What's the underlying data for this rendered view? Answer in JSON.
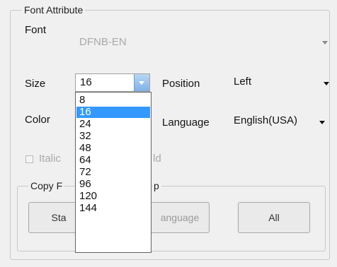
{
  "font_attribute": {
    "group_title": "Font Attribute",
    "font_label": "Font",
    "font_value": "DFNB-EN",
    "size_label": "Size",
    "size_value": "16",
    "size_options": [
      "8",
      "16",
      "24",
      "32",
      "48",
      "64",
      "72",
      "96",
      "120",
      "144"
    ],
    "size_selected_index": 1,
    "position_label": "Position",
    "position_value": "Left",
    "color_label": "Color",
    "language_label": "Language",
    "language_value": "English(USA)",
    "italic_label": "Italic",
    "bold_label_partial": "ld"
  },
  "copy_group": {
    "title_left": "Copy F",
    "title_right": "p",
    "buttons": {
      "standard_partial": "Sta",
      "language_partial": "anguage",
      "all": "All"
    }
  },
  "colors": {
    "selection": "#3399ff",
    "disabled_text": "#a9a9a9"
  },
  "icons": [
    "dropdown-arrow-icon",
    "checkbox-icon"
  ]
}
